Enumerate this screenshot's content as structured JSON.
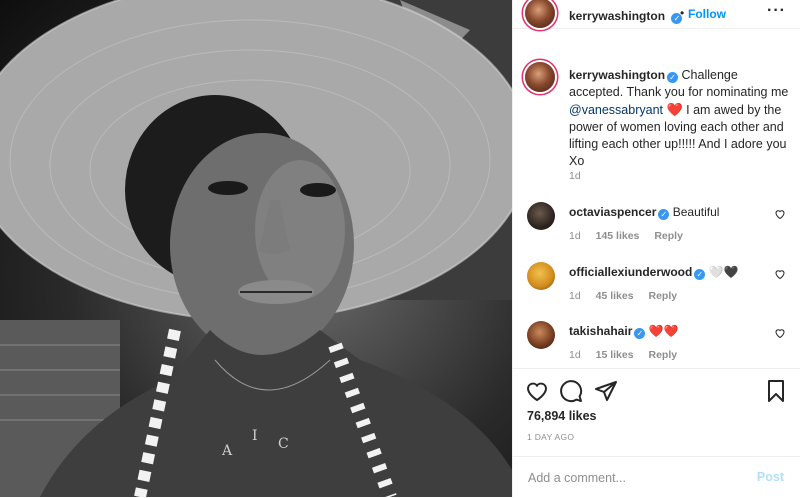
{
  "post": {
    "image_alt": "Black and white selfie under a wide straw sun hat",
    "author": {
      "username": "kerrywashington",
      "verified": true,
      "separator": "•",
      "follow_label": "Follow",
      "more_icon": "more-icon"
    },
    "caption": {
      "username": "kerrywashington",
      "text_before": "Challenge accepted. Thank you for nominating me ",
      "mention": "@vanessabryant",
      "heart": "❤️",
      "text_after": " I am awed by the power of women loving each other and lifting each other up!!!!! And I adore you Xo",
      "time": "1d"
    },
    "comments": [
      {
        "username": "octaviaspencer",
        "verified": true,
        "text": "Beautiful",
        "time": "1d",
        "likes": "145 likes",
        "reply": "Reply"
      },
      {
        "username": "officiallexiunderwood",
        "verified": true,
        "text": "🤍🖤",
        "time": "1d",
        "likes": "45 likes",
        "reply": "Reply"
      },
      {
        "username": "takishahair",
        "verified": true,
        "text": "❤️❤️",
        "time": "1d",
        "likes": "15 likes",
        "reply": "Reply"
      }
    ],
    "likes_count": "76,894 likes",
    "date": "1 DAY AGO",
    "add_comment": {
      "placeholder": "Add a comment...",
      "post_label": "Post"
    }
  },
  "colors": {
    "link_blue": "#0095f6",
    "verified_blue": "#3897f0",
    "post_disabled": "#b2dffc",
    "heart_red": "#ed2d2d",
    "muted": "#8e8e8e"
  }
}
